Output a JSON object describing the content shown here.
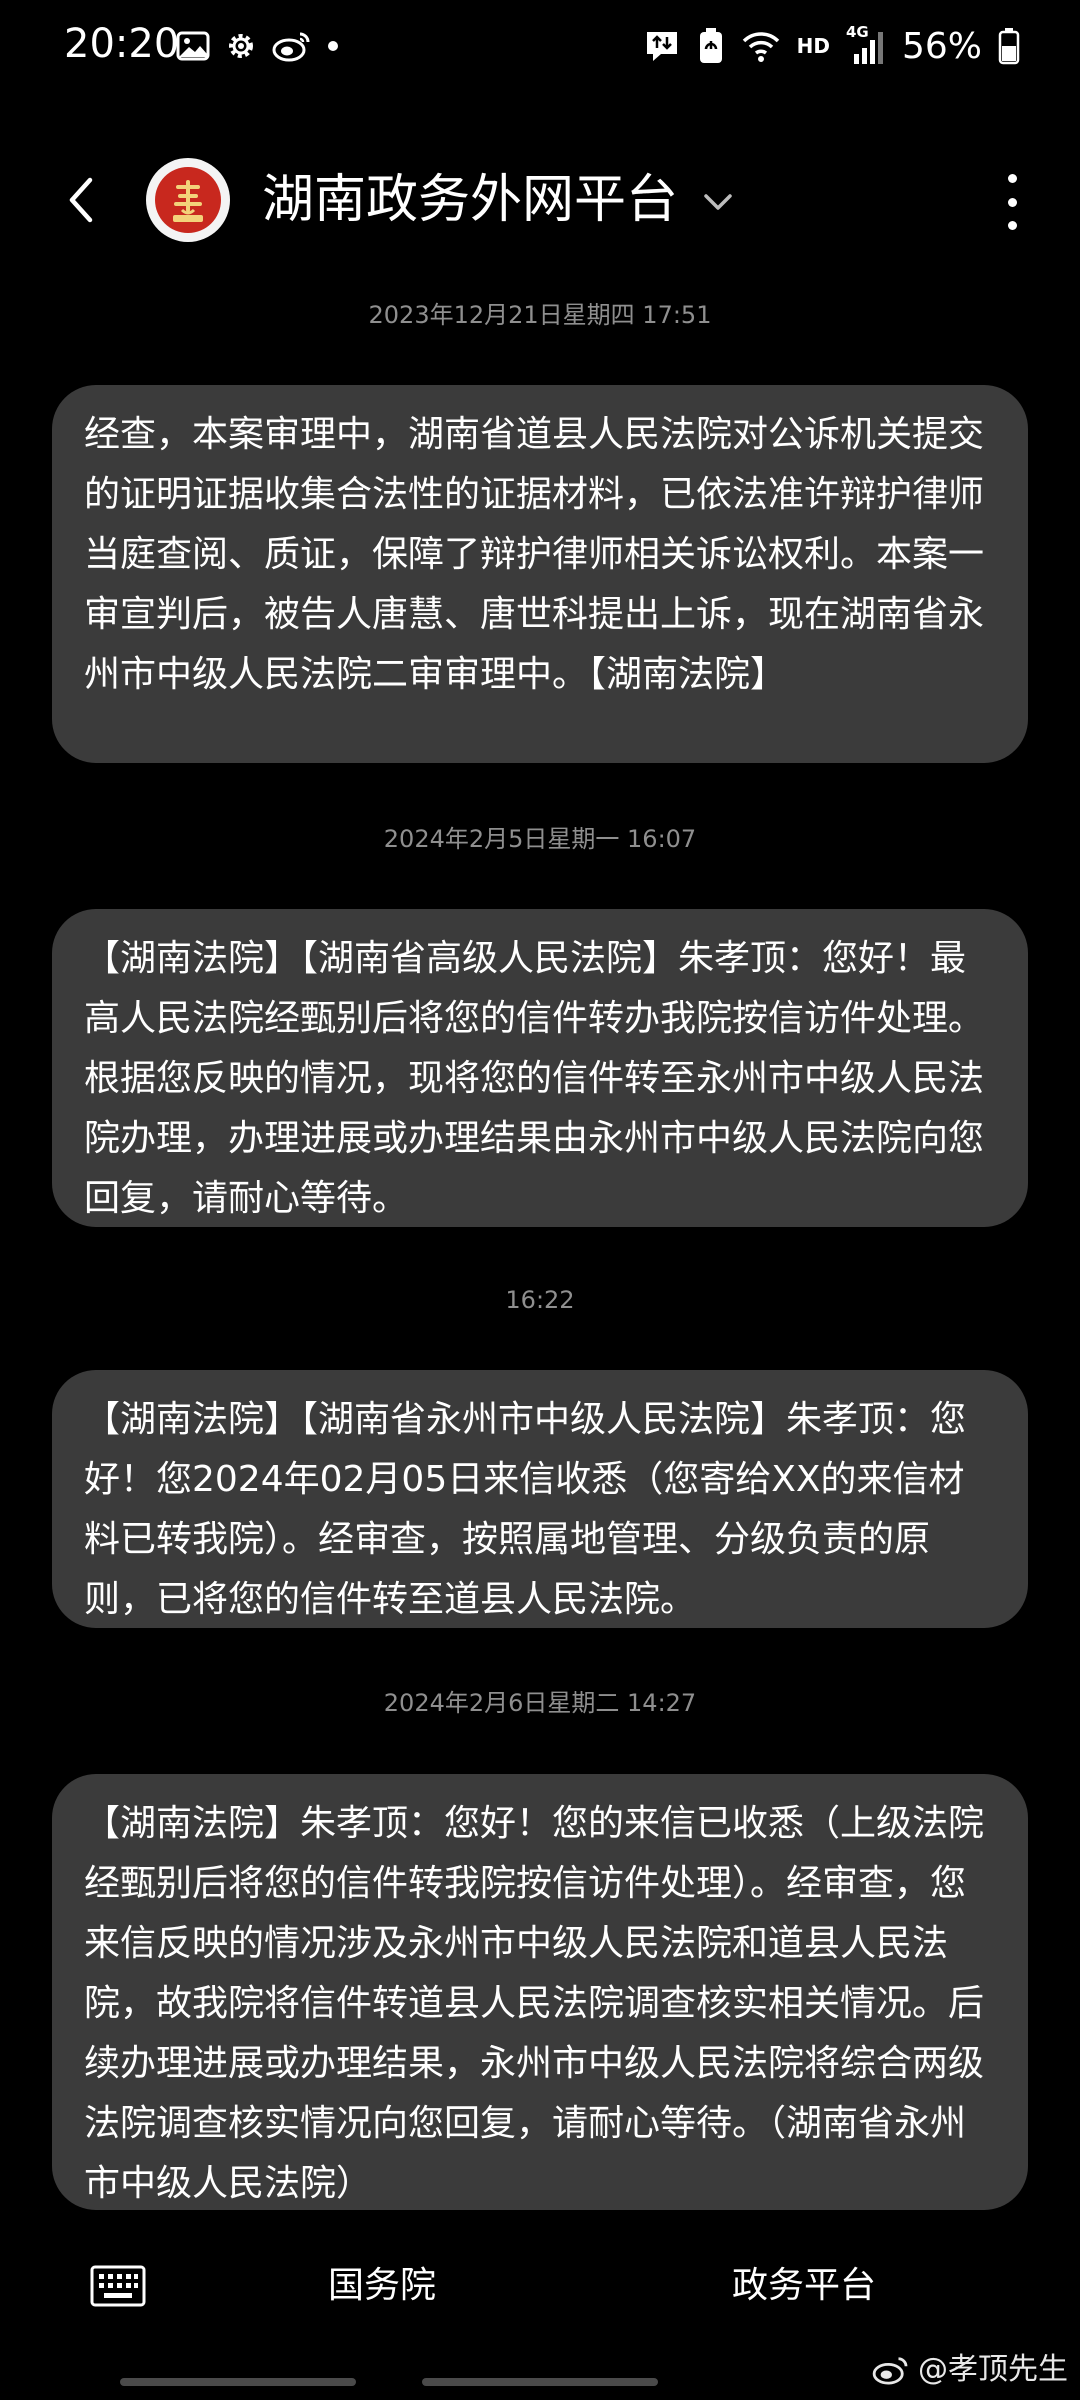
{
  "status_bar": {
    "time": "20:20",
    "left_icons": [
      "image-icon",
      "gear-icon",
      "weibo-icon",
      "dot-icon"
    ],
    "right_icons": [
      "data-transfer-icon",
      "battery-saver-icon",
      "wifi-icon",
      "signal-icon",
      "battery-icon"
    ],
    "network_label": "HD",
    "network_type": "4G",
    "battery_percent": "56%"
  },
  "header": {
    "contact_name": "湖南政务外网平台",
    "avatar_icon": "court-emblem-icon"
  },
  "messages": [
    {
      "date": "2023年12月21日星期四 17:51",
      "text": "经查，本案审理中，湖南省道县人民法院对公诉机关提交的证明证据收集合法性的证据材料，已依法准许辩护律师当庭查阅、质证，保障了辩护律师相关诉讼权利。本案一审宣判后，被告人唐慧、唐世科提出上诉，现在湖南省永州市中级人民法院二审审理中。【湖南法院】"
    },
    {
      "date": "2024年2月5日星期一 16:07",
      "text": "【湖南法院】【湖南省高级人民法院】朱孝顶：您好！最高人民法院经甄别后将您的信件转办我院按信访件处理。根据您反映的情况，现将您的信件转至永州市中级人民法院办理，办理进展或办理结果由永州市中级人民法院向您回复，请耐心等待。"
    },
    {
      "date": "16:22",
      "text": "【湖南法院】【湖南省永州市中级人民法院】朱孝顶：您好！您2024年02月05日来信收悉（您寄给XX的来信材料已转我院）。经审查，按照属地管理、分级负责的原则，已将您的信件转至道县人民法院。"
    },
    {
      "date": "2024年2月6日星期二 14:27",
      "text": "【湖南法院】朱孝顶：您好！您的来信已收悉（上级法院经甄别后将您的信件转我院按信访件处理）。经审查，您来信反映的情况涉及永州市中级人民法院和道县人民法院，故我院将信件转道县人民法院调查核实相关情况。后续办理进展或办理结果，永州市中级人民法院将综合两级法院调查核实情况向您回复，请耐心等待。（湖南省永州市中级人民法院）"
    }
  ],
  "bottom_bar": {
    "keyboard_icon": "keyboard-icon",
    "menu_1": "国务院",
    "menu_2": "政务平台"
  },
  "watermark": {
    "text": "@孝顶先生",
    "icon": "weibo-icon"
  },
  "colors": {
    "background": "#000000",
    "bubble": "#3b3b3b",
    "date_text": "#8f8f8f",
    "avatar_red": "#c8281e"
  }
}
